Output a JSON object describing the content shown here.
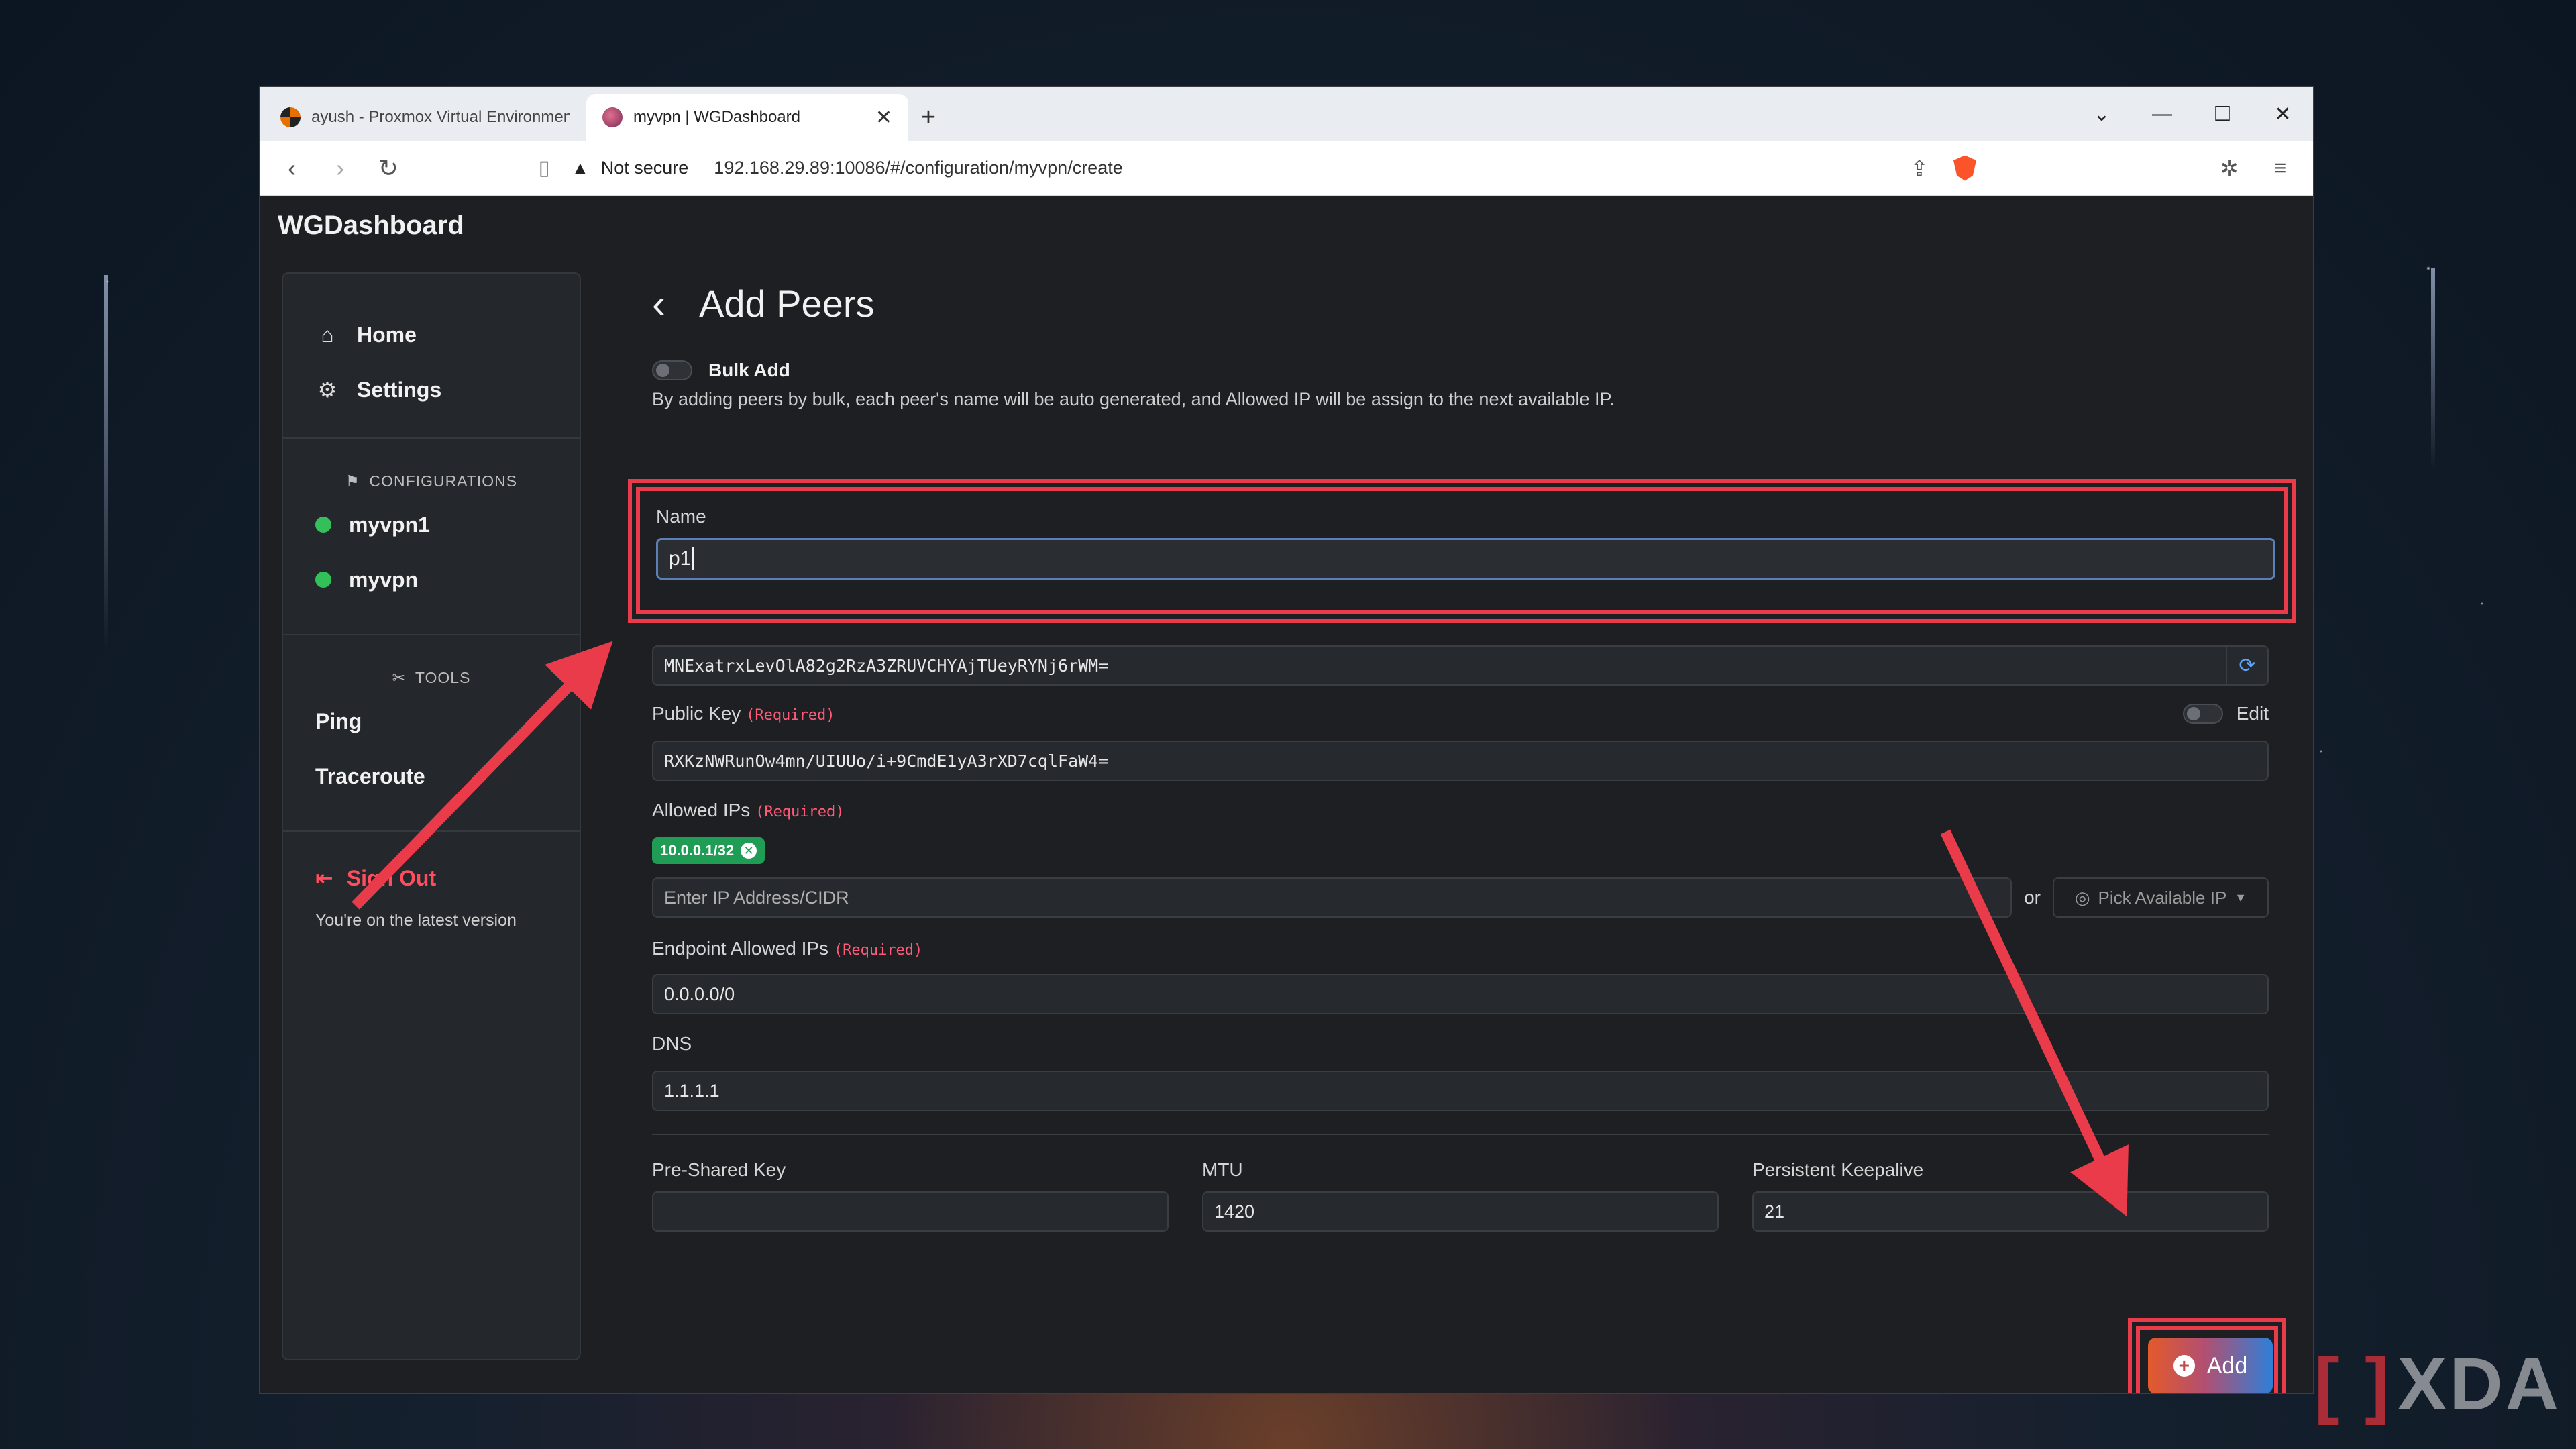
{
  "browser": {
    "tabs": [
      {
        "title": "ayush - Proxmox Virtual Environment",
        "active": false,
        "favicon_color": "#e57000"
      },
      {
        "title": "myvpn | WGDashboard",
        "active": true,
        "favicon_color": "#c24d6b"
      }
    ],
    "security_label": "Not secure",
    "url": "192.168.29.89:10086/#/configuration/myvpn/create"
  },
  "app": {
    "brand": "WGDashboard",
    "sidebar": {
      "nav": [
        {
          "label": "Home",
          "icon": "home-icon"
        },
        {
          "label": "Settings",
          "icon": "gear-icon"
        }
      ],
      "configurations_title": "CONFIGURATIONS",
      "configurations": [
        {
          "label": "myvpn1",
          "status_color": "#33c05a"
        },
        {
          "label": "myvpn",
          "status_color": "#33c05a"
        }
      ],
      "tools_title": "TOOLS",
      "tools": [
        {
          "label": "Ping"
        },
        {
          "label": "Traceroute"
        }
      ],
      "sign_out": "Sign Out",
      "version": "You're on the latest version"
    },
    "form": {
      "title": "Add Peers",
      "bulk_add_label": "Bulk Add",
      "bulk_add_desc": "By adding peers by bulk, each peer's name will be auto generated, and Allowed IP will be assign to the next available IP.",
      "name_label": "Name",
      "name_value": "p1",
      "private_key_value": "MNExatrxLevOlA82g2RzA3ZRUVCHYAjTUeyRYNj6rWM=",
      "public_key_label": "Public Key",
      "required_tag": "(Required)",
      "edit_label": "Edit",
      "public_key_value": "RXKzNWRunOw4mn/UIUUo/i+9CmdE1yA3rXD7cqlFaW4=",
      "allowed_ips_label": "Allowed IPs",
      "allowed_ip_chip": "10.0.0.1/32",
      "ip_placeholder": "Enter IP Address/CIDR",
      "or_label": "or",
      "pick_ip_label": "Pick Available IP",
      "endpoint_label": "Endpoint Allowed IPs",
      "endpoint_value": "0.0.0.0/0",
      "dns_label": "DNS",
      "dns_value": "1.1.1.1",
      "psk_label": "Pre-Shared Key",
      "psk_value": "",
      "mtu_label": "MTU",
      "mtu_value": "1420",
      "keepalive_label": "Persistent Keepalive",
      "keepalive_value": "21",
      "add_label": "Add"
    }
  },
  "annotation_color": "#ea3b4b",
  "watermark": "XDA"
}
